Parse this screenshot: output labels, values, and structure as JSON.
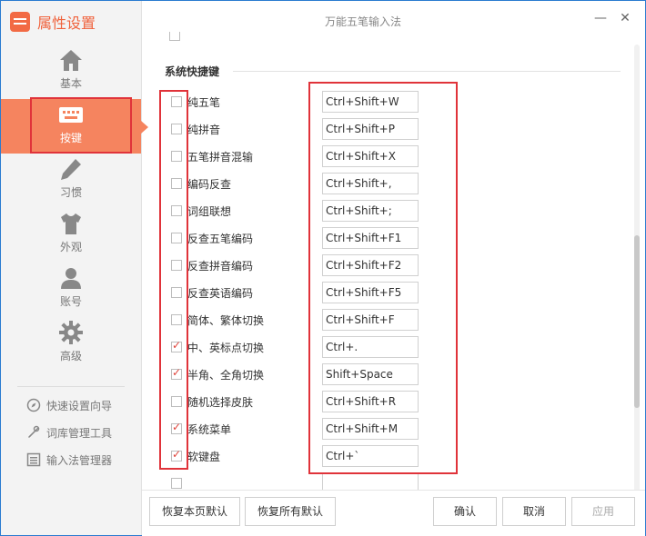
{
  "window": {
    "title": "万能五笔输入法",
    "minimize": "—",
    "close": "✕"
  },
  "brand": {
    "title": "属性设置"
  },
  "sidebar": {
    "items": [
      {
        "label": "基本",
        "icon": "home-icon"
      },
      {
        "label": "按键",
        "icon": "keyboard-icon"
      },
      {
        "label": "习惯",
        "icon": "pencil-icon"
      },
      {
        "label": "外观",
        "icon": "tshirt-icon"
      },
      {
        "label": "账号",
        "icon": "user-icon"
      },
      {
        "label": "高级",
        "icon": "gear-icon"
      }
    ],
    "active_index": 1,
    "tools": [
      {
        "label": "快速设置向导",
        "icon": "compass-icon"
      },
      {
        "label": "词库管理工具",
        "icon": "tools-icon"
      },
      {
        "label": "输入法管理器",
        "icon": "list-icon"
      }
    ]
  },
  "section": {
    "title": "系统快捷键"
  },
  "shortcuts": [
    {
      "label": "纯五笔",
      "checked": false,
      "hotkey": "Ctrl+Shift+W"
    },
    {
      "label": "纯拼音",
      "checked": false,
      "hotkey": "Ctrl+Shift+P"
    },
    {
      "label": "五笔拼音混输",
      "checked": false,
      "hotkey": "Ctrl+Shift+X"
    },
    {
      "label": "编码反查",
      "checked": false,
      "hotkey": "Ctrl+Shift+,"
    },
    {
      "label": "词组联想",
      "checked": false,
      "hotkey": "Ctrl+Shift+;"
    },
    {
      "label": "反查五笔编码",
      "checked": false,
      "hotkey": "Ctrl+Shift+F1"
    },
    {
      "label": "反查拼音编码",
      "checked": false,
      "hotkey": "Ctrl+Shift+F2"
    },
    {
      "label": "反查英语编码",
      "checked": false,
      "hotkey": "Ctrl+Shift+F5"
    },
    {
      "label": "简体、繁体切换",
      "checked": false,
      "hotkey": "Ctrl+Shift+F"
    },
    {
      "label": "中、英标点切换",
      "checked": true,
      "hotkey": "Ctrl+."
    },
    {
      "label": "半角、全角切换",
      "checked": true,
      "hotkey": "Shift+Space"
    },
    {
      "label": "随机选择皮肤",
      "checked": false,
      "hotkey": "Ctrl+Shift+R"
    },
    {
      "label": "系统菜单",
      "checked": true,
      "hotkey": "Ctrl+Shift+M"
    },
    {
      "label": "软键盘",
      "checked": true,
      "hotkey": "Ctrl+`"
    }
  ],
  "footer": {
    "restore_page": "恢复本页默认",
    "restore_all": "恢复所有默认",
    "ok": "确认",
    "cancel": "取消",
    "apply": "应用"
  },
  "colors": {
    "accent": "#f5845f",
    "brand": "#f0623c",
    "highlight": "#e0333a",
    "check": "#e0453c"
  }
}
